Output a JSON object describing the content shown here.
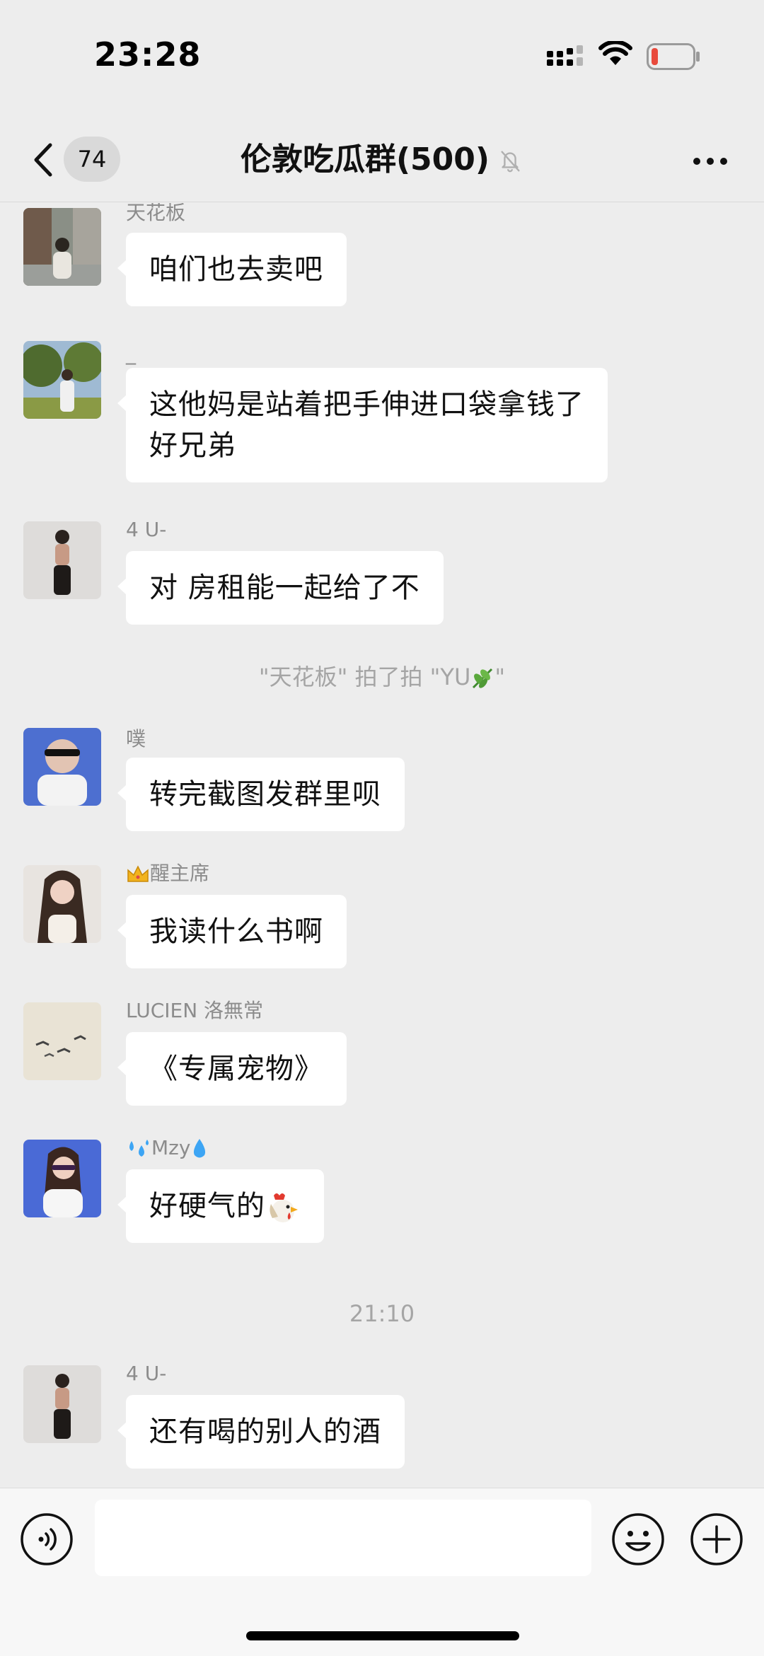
{
  "status_bar": {
    "time": "23:28"
  },
  "nav": {
    "unread_count": "74",
    "title": "伦敦吃瓜群(500)"
  },
  "messages": [
    {
      "sender": "天花板",
      "text": "咱们也去卖吧",
      "avatar": "street-photo-avatar"
    },
    {
      "sender": "_",
      "text": "这他妈是站着把手伸进口袋拿钱了\n 好兄弟",
      "avatar": "park-photo-avatar"
    },
    {
      "sender": "4 U-",
      "text": "对 房租能一起给了不",
      "avatar": "girl-photo-avatar"
    },
    {
      "sender": "噗",
      "text": "转完截图发群里呗",
      "avatar": "sunglasses-photo-avatar"
    },
    {
      "sender": "醒主席",
      "sender_prefix_icon": "crown",
      "text": "我读什么书啊",
      "avatar": "longhair-photo-avatar"
    },
    {
      "sender": "LUCIEN 洛無常",
      "text": "《专属宠物》",
      "avatar": "birds-photo-avatar"
    },
    {
      "sender": "Mzy",
      "sender_prefix_icon": "sweat-droplets",
      "sender_suffix_icon": "droplet",
      "text": "好硬气的",
      "text_suffix_icon": "chicken",
      "avatar": "selfie-photo-avatar"
    },
    {
      "sender": "4 U-",
      "text": "还有喝的别人的酒",
      "avatar": "girl-photo-avatar"
    }
  ],
  "system_note": {
    "prefix": "\"天花板\" 拍了拍 \"YU",
    "suffix": "\"",
    "icon": "herb"
  },
  "time_divider": "21:10",
  "colors": {
    "background": "#ededed",
    "bubble": "#ffffff",
    "meta_text": "#8c8c8c",
    "battery_low": "#e84a3c"
  }
}
